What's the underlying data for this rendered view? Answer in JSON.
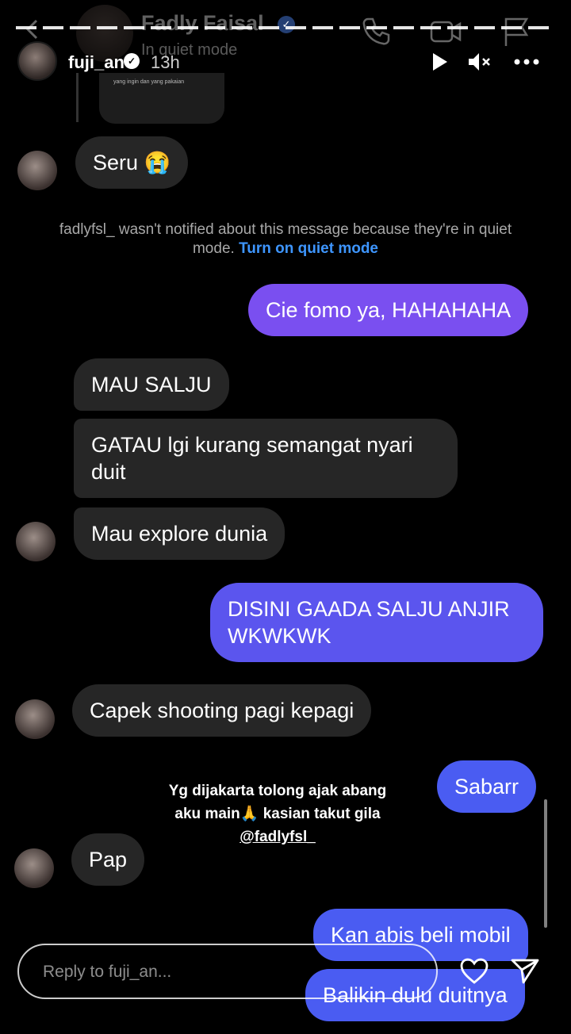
{
  "chat_header": {
    "name": "Fadly Faisal",
    "status": "In quiet mode"
  },
  "story": {
    "username": "fuji_an",
    "time": "13h"
  },
  "prev_media_caption": "yang ingin dan yang pakaian",
  "notice": {
    "text": "fadlyfsl_ wasn't notified about this message because they're in quiet mode.",
    "link": "Turn on quiet mode"
  },
  "messages": [
    {
      "side": "in",
      "text": "Seru 😭"
    },
    {
      "side": "out",
      "text": "Cie fomo ya, HAHAHAHA"
    },
    {
      "side": "in",
      "text": "MAU SALJU"
    },
    {
      "side": "in",
      "text": "GATAU lgi kurang semangat nyari duit"
    },
    {
      "side": "in",
      "text": "Mau explore dunia"
    },
    {
      "side": "out",
      "text": "DISINI GAADA SALJU ANJIR WKWKWK"
    },
    {
      "side": "in",
      "text": "Capek shooting pagi kepagi"
    },
    {
      "side": "out",
      "text": "Sabarr"
    },
    {
      "side": "in",
      "text": "Pap"
    },
    {
      "side": "out",
      "text": "Kan abis beli mobil"
    },
    {
      "side": "out",
      "text": "Balikin dulu duitnya"
    }
  ],
  "overlay": {
    "line1": "Yg dijakarta tolong ajak abang",
    "line2": "aku main🙏 kasian takut gila",
    "mention": "@fadlyfsl_"
  },
  "reply": {
    "placeholder": "Reply to fuji_an..."
  },
  "colors": {
    "purple": "#7a4ff0",
    "indigo": "#5b55ee",
    "blue": "#4a5cf2",
    "incoming": "#262626",
    "link": "#3e96ff"
  },
  "icons": [
    "back-icon",
    "phone-icon",
    "video-icon",
    "flag-icon",
    "play-icon",
    "mute-icon",
    "more-icon",
    "heart-icon",
    "send-icon"
  ]
}
